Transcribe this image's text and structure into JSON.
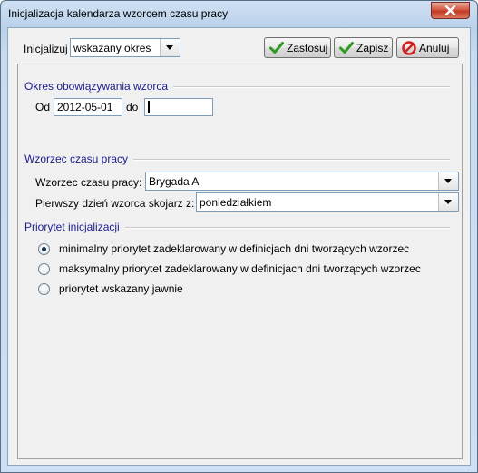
{
  "window": {
    "title": "Inicjalizacja kalendarza wzorcem czasu pracy"
  },
  "toolbar": {
    "init_label": "Inicjalizuj",
    "init_value": "wskazany okres",
    "apply_label": "Zastosuj",
    "save_label": "Zapisz",
    "cancel_label": "Anuluj"
  },
  "period": {
    "title": "Okres obowiązywania wzorca",
    "from_label": "Od",
    "from_value": "2012-05-01",
    "to_label": "do",
    "to_value": ""
  },
  "pattern": {
    "title": "Wzorzec czasu pracy",
    "pattern_label": "Wzorzec czasu pracy:",
    "pattern_value": "Brygada A",
    "firstday_label": "Pierwszy dzień wzorca skojarz z:",
    "firstday_value": "poniedziałkiem"
  },
  "priority": {
    "title": "Priorytet inicjalizacji",
    "options": [
      {
        "label": "minimalny priorytet zadeklarowany w definicjach dni tworzących wzorzec",
        "selected": true
      },
      {
        "label": "maksymalny priorytet zadeklarowany w definicjach dni tworzących wzorzec",
        "selected": false
      },
      {
        "label": "priorytet wskazany jawnie",
        "selected": false
      }
    ]
  },
  "icons": {
    "close": "close-icon",
    "dropdown": "chevron-down-icon",
    "apply": "check-icon",
    "save": "check-icon",
    "cancel": "no-entry-icon"
  },
  "colors": {
    "group_title": "#1c1c8e",
    "check_green": "#2e9a22",
    "cancel_red": "#d02020"
  }
}
